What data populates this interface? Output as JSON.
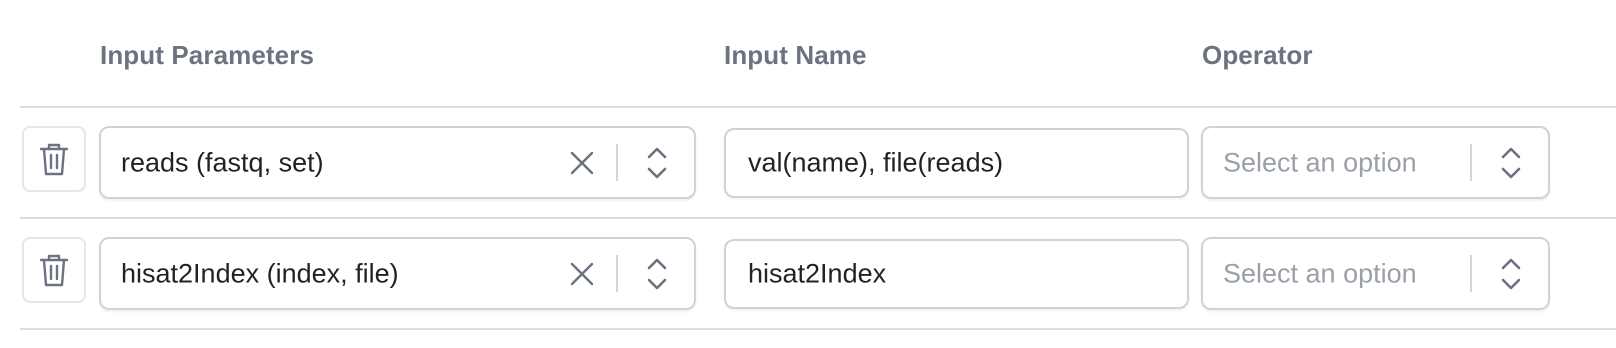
{
  "headers": {
    "input_parameters": "Input Parameters",
    "input_name": "Input Name",
    "operator": "Operator"
  },
  "rows": [
    {
      "parameter": "reads (fastq, set)",
      "input_name": "val(name), file(reads)",
      "operator_placeholder": "Select an option"
    },
    {
      "parameter": "hisat2Index (index, file)",
      "input_name": "hisat2Index",
      "operator_placeholder": "Select an option"
    }
  ],
  "icons": {
    "delete": "trash-icon",
    "clear": "close-icon",
    "toggle": "chevron-up-down-icon"
  },
  "colors": {
    "header_text": "#6b7280",
    "value_text": "#1f2328",
    "placeholder_text": "#9aa0a8",
    "border": "#cfd3d9"
  }
}
